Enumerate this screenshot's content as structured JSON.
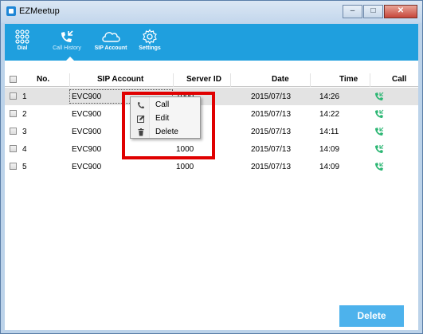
{
  "window": {
    "title": "EZMeetup",
    "controls": [
      "–",
      "□",
      "✕"
    ]
  },
  "toolbar": {
    "items": [
      {
        "label": "Dial",
        "icon": "dialpad-icon"
      },
      {
        "label": "Call History",
        "icon": "call-history-icon",
        "active": true
      },
      {
        "label": "SIP Account",
        "icon": "cloud-icon"
      },
      {
        "label": "Settings",
        "icon": "gear-icon"
      }
    ],
    "color": "#1f9fde"
  },
  "table": {
    "headers": {
      "no": "No.",
      "sip": "SIP Account",
      "server": "Server ID",
      "date": "Date",
      "time": "Time",
      "call": "Call"
    },
    "rows": [
      {
        "no": "1",
        "sip": "EVC900",
        "server": "1000",
        "date": "2015/07/13",
        "time": "14:26"
      },
      {
        "no": "2",
        "sip": "EVC900",
        "server": "",
        "date": "2015/07/13",
        "time": "14:22"
      },
      {
        "no": "3",
        "sip": "EVC900",
        "server": "",
        "date": "2015/07/13",
        "time": "14:11"
      },
      {
        "no": "4",
        "sip": "EVC900",
        "server": "1000",
        "date": "2015/07/13",
        "time": "14:09"
      },
      {
        "no": "5",
        "sip": "EVC900",
        "server": "1000",
        "date": "2015/07/13",
        "time": "14:09"
      }
    ],
    "call_icon_color": "#2bb673"
  },
  "context_menu": {
    "items": [
      {
        "label": "Call",
        "icon": "phone-icon"
      },
      {
        "label": "Edit",
        "icon": "edit-icon"
      },
      {
        "label": "Delete",
        "icon": "trash-icon"
      }
    ],
    "highlight_color": "#e00000"
  },
  "footer": {
    "delete_label": "Delete"
  }
}
